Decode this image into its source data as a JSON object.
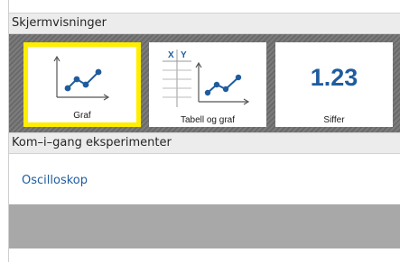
{
  "sections": {
    "screen_views_title": "Skjermvisninger",
    "get_started_title": "Kom–i–gang eksperimenter"
  },
  "tiles": [
    {
      "label": "Graf",
      "icon": "graph-icon",
      "selected": true
    },
    {
      "label": "Tabell og graf",
      "icon": "table-graph-icon",
      "selected": false
    },
    {
      "label": "Siffer",
      "icon": "digits-icon",
      "selected": false
    }
  ],
  "table_headers": {
    "x": "X",
    "y": "Y"
  },
  "digits_value": "1.23",
  "experiments": [
    {
      "label": "Oscilloskop"
    }
  ],
  "colors": {
    "accent_blue": "#1f5c9e",
    "selection_yellow": "#ffee00",
    "tile_background_gray": "#6a6a6a",
    "empty_area_gray": "#a8a8a8"
  }
}
